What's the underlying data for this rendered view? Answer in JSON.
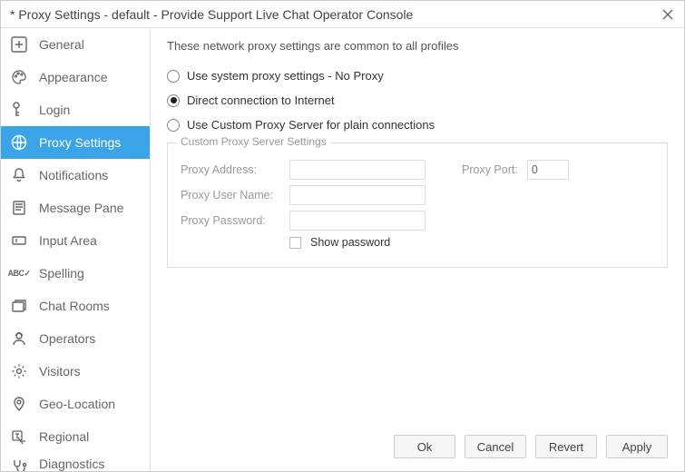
{
  "titlebar": {
    "title": "* Proxy Settings - default - Provide Support Live Chat Operator Console"
  },
  "sidebar": {
    "items": [
      {
        "label": "General"
      },
      {
        "label": "Appearance"
      },
      {
        "label": "Login"
      },
      {
        "label": "Proxy Settings"
      },
      {
        "label": "Notifications"
      },
      {
        "label": "Message Pane"
      },
      {
        "label": "Input Area"
      },
      {
        "label": "Spelling"
      },
      {
        "label": "Chat Rooms"
      },
      {
        "label": "Operators"
      },
      {
        "label": "Visitors"
      },
      {
        "label": "Geo-Location"
      },
      {
        "label": "Regional"
      },
      {
        "label": "Diagnostics"
      }
    ]
  },
  "main": {
    "intro": "These network proxy settings are common to all profiles",
    "radios": {
      "system": "Use system proxy settings - No Proxy",
      "direct": "Direct connection to Internet",
      "custom": "Use Custom Proxy Server for plain connections"
    },
    "fieldset": {
      "legend": "Custom Proxy Server Settings",
      "address_label": "Proxy Address:",
      "address_value": "",
      "port_label": "Proxy Port:",
      "port_value": "0",
      "user_label": "Proxy User Name:",
      "user_value": "",
      "pass_label": "Proxy Password:",
      "pass_value": "",
      "showpass_label": "Show password"
    }
  },
  "buttons": {
    "ok": "Ok",
    "cancel": "Cancel",
    "revert": "Revert",
    "apply": "Apply"
  }
}
